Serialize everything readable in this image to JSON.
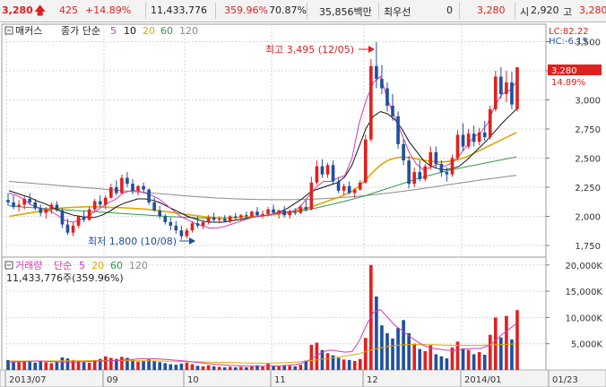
{
  "topbar": {
    "price": "3,280",
    "change": "425",
    "change_pct": "+14.89%",
    "volume": "11,433,776",
    "volume_ratio": "359.96%",
    "turnover": "70.87%",
    "amount": "35,856백만",
    "pref_label": "최우선",
    "pref_value": "0",
    "best_price": "3,280",
    "open_label": "시",
    "open_value": "2,920",
    "high_label": "고",
    "high_value": "3,280",
    "up_arrow_icon": "up-arrow-icon"
  },
  "price_panel": {
    "indicator_name": "매커스",
    "ma_title": "종가 단순",
    "ma_periods": [
      "5",
      "10",
      "20",
      "60",
      "120"
    ],
    "lc_label": "LC:82.22",
    "hc_label": "HC:-6.15",
    "current_price_tag": "3,280",
    "current_pct_tag": "14.89%",
    "high_note": "최고 3,495 (12/05)",
    "low_note": "최저 1,800 (10/08)"
  },
  "volume_panel": {
    "title": "거래량",
    "ma_title": "단순",
    "ma_periods": [
      "5",
      "20",
      "60",
      "120"
    ],
    "readout": "11,433,776주(359.96%)"
  },
  "colors": {
    "up": "#e02020",
    "down": "#1f4fa0",
    "ma5": "#d23bb3",
    "ma10": "#111111",
    "ma20": "#e0a800",
    "ma60": "#2e9a48",
    "ma120": "#8a8a8a"
  },
  "chart_data": {
    "type": "candlestick",
    "x_tick_labels": [
      "2013/07",
      "09",
      "10",
      "11",
      "12",
      "2014/01",
      "01/23"
    ],
    "price_axis": {
      "ylim": [
        1650,
        3650
      ],
      "ticks": [
        1750,
        2000,
        2250,
        2500,
        2750,
        3000,
        3250,
        3500
      ],
      "tick_labels": [
        "1,750",
        "2,000",
        "2,250",
        "2,500",
        "2,750",
        "3,000",
        "3,250",
        "3,500"
      ]
    },
    "volume_axis": {
      "ylim": [
        0,
        21500
      ],
      "ticks": [
        5000,
        10000,
        15000,
        20000
      ],
      "tick_labels": [
        "5,000K",
        "10,000K",
        "15,000K",
        "20,000K"
      ]
    },
    "candles": [
      [
        2140,
        2200,
        2090,
        2120,
        1900
      ],
      [
        2120,
        2180,
        2060,
        2080,
        1800
      ],
      [
        2080,
        2140,
        2040,
        2100,
        1500
      ],
      [
        2100,
        2170,
        2060,
        2150,
        1700
      ],
      [
        2150,
        2200,
        2100,
        2120,
        1600
      ],
      [
        2120,
        2150,
        2050,
        2070,
        1400
      ],
      [
        2070,
        2100,
        2000,
        2030,
        1800
      ],
      [
        2030,
        2080,
        1980,
        2060,
        1500
      ],
      [
        2060,
        2120,
        2020,
        2100,
        1300
      ],
      [
        2100,
        2130,
        2040,
        2050,
        1600
      ],
      [
        2050,
        2070,
        1900,
        1930,
        2400
      ],
      [
        1930,
        1980,
        1840,
        1860,
        2200
      ],
      [
        1860,
        1950,
        1830,
        1920,
        1900
      ],
      [
        1920,
        2010,
        1900,
        2000,
        1700
      ],
      [
        2000,
        2050,
        1950,
        1970,
        1500
      ],
      [
        1970,
        2080,
        1960,
        2060,
        1400
      ],
      [
        2060,
        2150,
        2040,
        2130,
        1900
      ],
      [
        2130,
        2180,
        2080,
        2100,
        2100
      ],
      [
        2100,
        2180,
        2060,
        2160,
        2600
      ],
      [
        2160,
        2280,
        2150,
        2250,
        2300
      ],
      [
        2250,
        2310,
        2180,
        2200,
        2100
      ],
      [
        2200,
        2360,
        2190,
        2330,
        2500
      ],
      [
        2330,
        2380,
        2250,
        2280,
        2300
      ],
      [
        2280,
        2320,
        2190,
        2220,
        1900
      ],
      [
        2220,
        2270,
        2180,
        2260,
        1600
      ],
      [
        2260,
        2290,
        2200,
        2230,
        1800
      ],
      [
        2230,
        2240,
        2100,
        2120,
        2000
      ],
      [
        2120,
        2160,
        2040,
        2050,
        1700
      ],
      [
        2050,
        2090,
        1980,
        2000,
        1500
      ],
      [
        2000,
        2020,
        1930,
        1950,
        1300
      ],
      [
        1950,
        1990,
        1880,
        1920,
        1100
      ],
      [
        1920,
        1960,
        1850,
        1880,
        1000
      ],
      [
        1880,
        1920,
        1800,
        1830,
        1200
      ],
      [
        1830,
        1900,
        1810,
        1880,
        1400
      ],
      [
        1880,
        1960,
        1860,
        1940,
        1100
      ],
      [
        1940,
        2000,
        1900,
        1920,
        800
      ],
      [
        1920,
        1970,
        1890,
        1950,
        700
      ],
      [
        1950,
        2010,
        1930,
        1990,
        900
      ],
      [
        1990,
        2030,
        1950,
        1970,
        700
      ],
      [
        1970,
        2000,
        1940,
        1980,
        600
      ],
      [
        1980,
        2010,
        1950,
        1960,
        500
      ],
      [
        1960,
        2010,
        1940,
        2000,
        600
      ],
      [
        2000,
        2030,
        1970,
        1990,
        500
      ],
      [
        1990,
        2020,
        1960,
        2010,
        600
      ],
      [
        2010,
        2040,
        1980,
        2000,
        500
      ],
      [
        2000,
        2050,
        1990,
        2040,
        700
      ],
      [
        2040,
        2080,
        2000,
        2010,
        900
      ],
      [
        2010,
        2050,
        1980,
        2020,
        700
      ],
      [
        2020,
        2080,
        2000,
        2060,
        1200
      ],
      [
        2060,
        2100,
        2020,
        2030,
        800
      ],
      [
        2030,
        2060,
        1980,
        2050,
        700
      ],
      [
        2050,
        2090,
        1990,
        2010,
        900
      ],
      [
        2010,
        2060,
        1980,
        2040,
        800
      ],
      [
        2040,
        2070,
        2010,
        2030,
        700
      ],
      [
        2030,
        2100,
        2020,
        2080,
        1000
      ],
      [
        2080,
        2140,
        2040,
        2060,
        1800
      ],
      [
        2060,
        2340,
        2050,
        2290,
        4800
      ],
      [
        2290,
        2480,
        2270,
        2430,
        5200
      ],
      [
        2430,
        2490,
        2330,
        2360,
        3800
      ],
      [
        2360,
        2460,
        2330,
        2440,
        3200
      ],
      [
        2440,
        2480,
        2280,
        2300,
        2800
      ],
      [
        2300,
        2330,
        2200,
        2220,
        2300
      ],
      [
        2220,
        2280,
        2180,
        2260,
        2000
      ],
      [
        2260,
        2300,
        2190,
        2200,
        1900
      ],
      [
        2200,
        2240,
        2160,
        2230,
        1700
      ],
      [
        2230,
        2310,
        2220,
        2290,
        2100
      ],
      [
        2290,
        2700,
        2280,
        2660,
        6100
      ],
      [
        2660,
        3350,
        2640,
        3290,
        20000
      ],
      [
        3290,
        3495,
        3100,
        3180,
        14000
      ],
      [
        3180,
        3300,
        3050,
        3100,
        8500
      ],
      [
        3100,
        3150,
        2900,
        2950,
        7000
      ],
      [
        2950,
        3050,
        2820,
        2860,
        6000
      ],
      [
        2860,
        2900,
        2580,
        2620,
        8000
      ],
      [
        2620,
        2660,
        2440,
        2480,
        9500
      ],
      [
        2480,
        2520,
        2240,
        2280,
        7000
      ],
      [
        2280,
        2420,
        2250,
        2380,
        5000
      ],
      [
        2380,
        2480,
        2300,
        2320,
        4000
      ],
      [
        2320,
        2450,
        2300,
        2430,
        3600
      ],
      [
        2430,
        2600,
        2400,
        2550,
        4700
      ],
      [
        2550,
        2600,
        2420,
        2450,
        3000
      ],
      [
        2450,
        2480,
        2340,
        2380,
        2600
      ],
      [
        2380,
        2420,
        2300,
        2360,
        2200
      ],
      [
        2360,
        2530,
        2340,
        2500,
        4300
      ],
      [
        2500,
        2740,
        2480,
        2700,
        5400
      ],
      [
        2700,
        2800,
        2560,
        2600,
        4100
      ],
      [
        2600,
        2750,
        2580,
        2710,
        3800
      ],
      [
        2710,
        2780,
        2600,
        2640,
        3000
      ],
      [
        2640,
        2760,
        2610,
        2720,
        3400
      ],
      [
        2720,
        2820,
        2650,
        2680,
        2900
      ],
      [
        2680,
        2950,
        2660,
        2920,
        6700
      ],
      [
        2920,
        3250,
        2900,
        3200,
        10000
      ],
      [
        3200,
        3280,
        3010,
        3050,
        6200
      ],
      [
        3050,
        3250,
        2980,
        3150,
        10300
      ],
      [
        3150,
        3240,
        2920,
        2960,
        5800
      ],
      [
        2920,
        3280,
        2900,
        3280,
        11400
      ]
    ],
    "ma5": [
      2200,
      2180,
      2150,
      2100,
      2080,
      2060,
      2040,
      2000,
      1960,
      1950,
      1970,
      2000,
      2040,
      2080,
      2120,
      2150,
      2200,
      2220,
      2220,
      2200,
      2180,
      2150,
      2100,
      2050,
      2000,
      1970,
      1940,
      1920,
      1900,
      1900,
      1910,
      1930,
      1950,
      1970,
      1990,
      2000,
      2010,
      2020,
      2030,
      2040,
      2050,
      2100,
      2180,
      2250,
      2300,
      2300,
      2330,
      2350,
      2500,
      2800,
      3000,
      3150,
      3200,
      3000,
      2850,
      2700,
      2550,
      2450,
      2400,
      2420,
      2450,
      2430,
      2460,
      2520,
      2600,
      2680,
      2720,
      2800,
      2950,
      3050,
      3080,
      3150
    ],
    "ma10": [
      2220,
      2200,
      2180,
      2160,
      2130,
      2110,
      2080,
      2050,
      2030,
      2010,
      2000,
      1990,
      1990,
      2010,
      2040,
      2080,
      2110,
      2130,
      2150,
      2150,
      2140,
      2120,
      2090,
      2060,
      2030,
      2000,
      1980,
      1960,
      1950,
      1950,
      1950,
      1960,
      1970,
      1980,
      1990,
      2000,
      2010,
      2020,
      2040,
      2070,
      2110,
      2150,
      2200,
      2230,
      2250,
      2270,
      2290,
      2340,
      2440,
      2600,
      2760,
      2860,
      2900,
      2880,
      2830,
      2750,
      2640,
      2560,
      2480,
      2430,
      2410,
      2400,
      2410,
      2430,
      2480,
      2540,
      2600,
      2660,
      2730,
      2800,
      2860,
      2920
    ],
    "ma20": [
      2000,
      2010,
      2020,
      2030,
      2040,
      2050,
      2060,
      2070,
      2075,
      2078,
      2080,
      2082,
      2082,
      2080,
      2078,
      2076,
      2074,
      2070,
      2066,
      2062,
      2056,
      2048,
      2040,
      2032,
      2024,
      2016,
      2008,
      2000,
      1993,
      1988,
      1986,
      1987,
      1990,
      1994,
      1998,
      2003,
      2008,
      2015,
      2024,
      2034,
      2046,
      2060,
      2077,
      2096,
      2117,
      2140,
      2160,
      2185,
      2215,
      2260,
      2320,
      2385,
      2440,
      2480,
      2500,
      2510,
      2505,
      2495,
      2482,
      2472,
      2468,
      2468,
      2476,
      2490,
      2510,
      2540,
      2570,
      2600,
      2630,
      2660,
      2690,
      2720
    ],
    "ma60": [
      2090,
      2085,
      2080,
      2076,
      2072,
      2068,
      2064,
      2060,
      2056,
      2052,
      2048,
      2044,
      2040,
      2036,
      2032,
      2028,
      2024,
      2020,
      2016,
      2012,
      2008,
      2004,
      2000,
      1996,
      1993,
      1990,
      1988,
      1986,
      1985,
      1985,
      1986,
      1988,
      1990,
      1993,
      1997,
      2001,
      2006,
      2012,
      2020,
      2028,
      2038,
      2048,
      2060,
      2072,
      2086,
      2100,
      2115,
      2130,
      2146,
      2163,
      2180,
      2200,
      2220,
      2240,
      2260,
      2280,
      2300,
      2320,
      2338,
      2355,
      2370,
      2385,
      2400,
      2413,
      2426,
      2438,
      2450,
      2462,
      2474,
      2486,
      2498,
      2510
    ],
    "ma120": [
      2300,
      2295,
      2290,
      2285,
      2280,
      2275,
      2270,
      2265,
      2260,
      2255,
      2250,
      2245,
      2240,
      2235,
      2230,
      2225,
      2220,
      2215,
      2210,
      2205,
      2200,
      2195,
      2190,
      2185,
      2180,
      2175,
      2170,
      2166,
      2162,
      2158,
      2155,
      2152,
      2150,
      2148,
      2146,
      2145,
      2144,
      2143,
      2143,
      2143,
      2144,
      2145,
      2147,
      2149,
      2152,
      2155,
      2159,
      2163,
      2168,
      2173,
      2179,
      2185,
      2192,
      2199,
      2207,
      2215,
      2223,
      2231,
      2240,
      2249,
      2258,
      2267,
      2276,
      2285,
      2294,
      2303,
      2312,
      2320,
      2328,
      2336,
      2344,
      2352
    ],
    "vol_ma5": [
      1500,
      1550,
      1600,
      1650,
      1700,
      1650,
      1600,
      1550,
      1500,
      1500,
      1550,
      1600,
      1650,
      1700,
      1750,
      1800,
      1900,
      2000,
      2100,
      2150,
      2150,
      2100,
      2000,
      1900,
      1800,
      1650,
      1500,
      1350,
      1200,
      1050,
      950,
      850,
      800,
      750,
      720,
      700,
      720,
      760,
      800,
      900,
      1000,
      1300,
      1900,
      2700,
      3500,
      3800,
      3600,
      3400,
      3500,
      5500,
      8500,
      11000,
      11500,
      10000,
      8500,
      7500,
      6500,
      5500,
      4700,
      4200,
      4000,
      3800,
      3700,
      3800,
      4000,
      4100,
      4100,
      4600,
      5500,
      6800,
      7800,
      8800
    ],
    "vol_ma20": [
      1700,
      1700,
      1700,
      1700,
      1700,
      1710,
      1720,
      1730,
      1740,
      1750,
      1760,
      1770,
      1780,
      1790,
      1800,
      1800,
      1790,
      1780,
      1760,
      1740,
      1720,
      1700,
      1680,
      1650,
      1620,
      1590,
      1560,
      1530,
      1500,
      1470,
      1440,
      1410,
      1380,
      1350,
      1320,
      1300,
      1300,
      1320,
      1360,
      1420,
      1500,
      1600,
      1740,
      1900,
      2080,
      2260,
      2450,
      2650,
      2850,
      3100,
      3500,
      3900,
      4200,
      4450,
      4650,
      4800,
      4850,
      4850,
      4830,
      4800,
      4770,
      4740,
      4710,
      4690,
      4680,
      4680,
      4700,
      4730,
      4780,
      4840,
      4900,
      4980
    ]
  }
}
